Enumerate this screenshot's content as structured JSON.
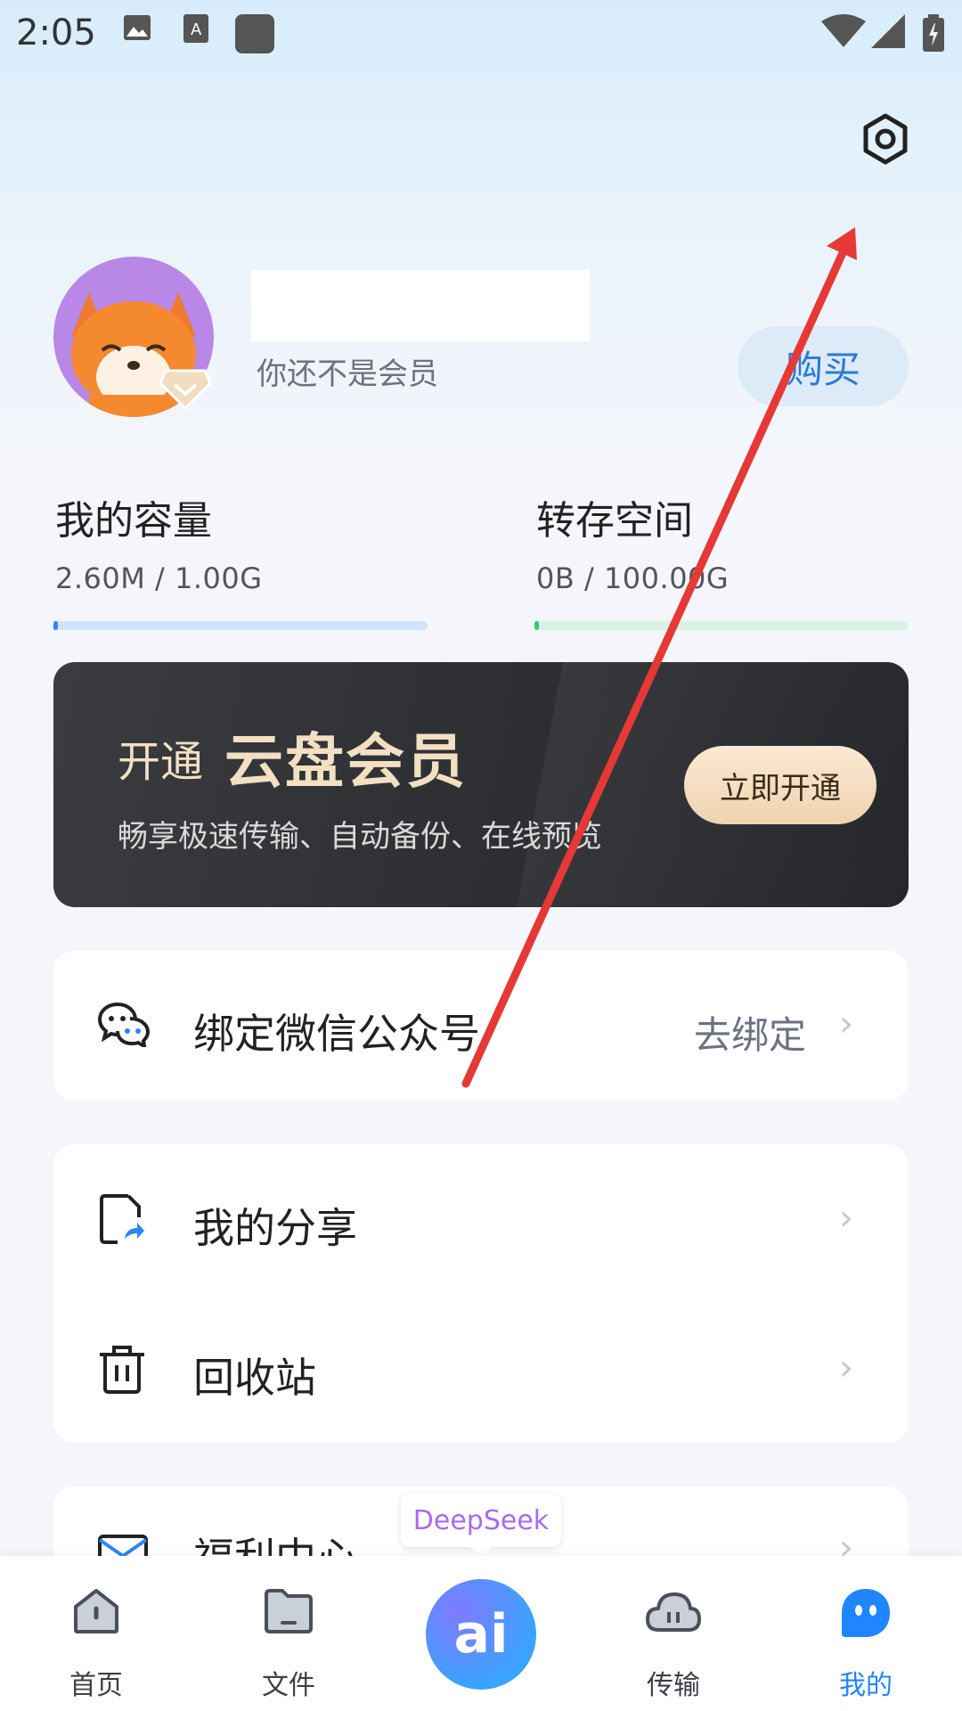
{
  "status_bar": {
    "time": "2:05"
  },
  "profile": {
    "member_status": "你还不是会员",
    "buy_label": "购买"
  },
  "capacity": {
    "my_title": "我的容量",
    "my_value": "2.60M / 1.00G",
    "my_fraction": 0.0025,
    "transfer_title": "转存空间",
    "transfer_value": "0B / 100.00G",
    "transfer_fraction": 0.0,
    "colors": {
      "my_bar": "#cfe3fb",
      "my_fill": "#2f86f5",
      "transfer_bar": "#d8f3e4",
      "transfer_fill": "#2ecc71"
    }
  },
  "vip_banner": {
    "title_prefix": "开通",
    "title_main": "云盘会员",
    "subtitle": "畅享极速传输、自动备份、在线预览",
    "button": "立即开通"
  },
  "menu": {
    "wechat": {
      "label": "绑定微信公众号",
      "action": "去绑定"
    },
    "share": {
      "label": "我的分享"
    },
    "trash": {
      "label": "回收站"
    },
    "welfare": {
      "label": "福利中心"
    }
  },
  "deepseek_tag": "DeepSeek",
  "tabbar": {
    "home": "首页",
    "files": "文件",
    "ai": "ai",
    "transfer": "传输",
    "mine": "我的"
  },
  "colors": {
    "accent": "#1f86ff",
    "annotation_arrow": "#e53935"
  }
}
